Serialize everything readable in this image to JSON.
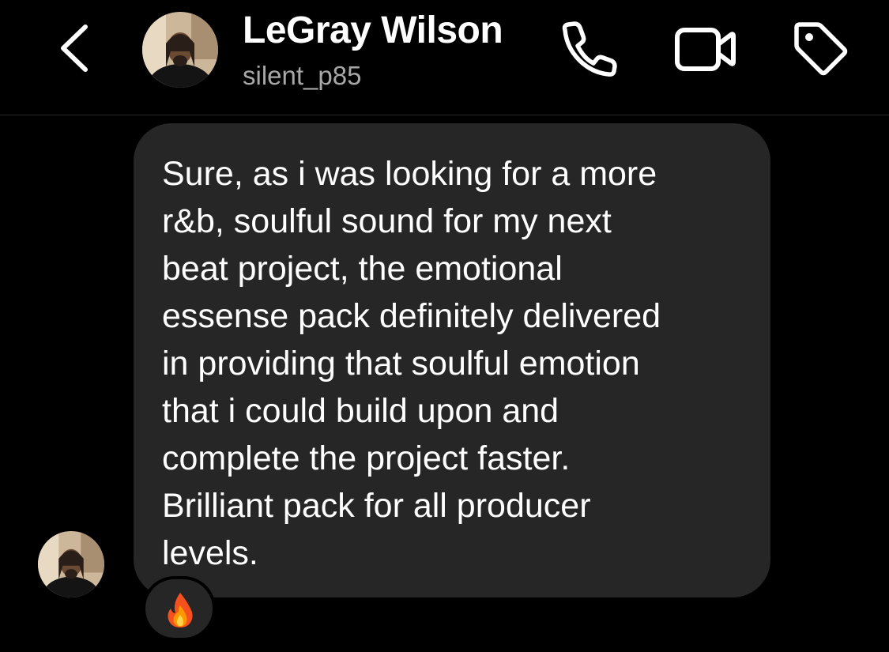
{
  "header": {
    "contact_name": "LeGray Wilson",
    "contact_handle": "silent_p85",
    "icons": {
      "back": "chevron-left-icon",
      "call": "phone-icon",
      "video": "video-camera-icon",
      "tag": "tag-icon"
    }
  },
  "conversation": {
    "message": {
      "lines": [
        "Sure, as i was looking for a more",
        "r&b, soulful sound for my next",
        "beat project, the emotional",
        "essense pack definitely delivered",
        "in providing that soulful emotion",
        "that i could build upon and",
        "complete the project faster.",
        "Brilliant pack for all producer",
        "levels."
      ],
      "reaction": "fire-emoji"
    }
  },
  "colors": {
    "background": "#000000",
    "bubble": "#262626",
    "primary_text": "#ffffff",
    "secondary_text": "#a8a8a8",
    "divider": "#262626"
  }
}
